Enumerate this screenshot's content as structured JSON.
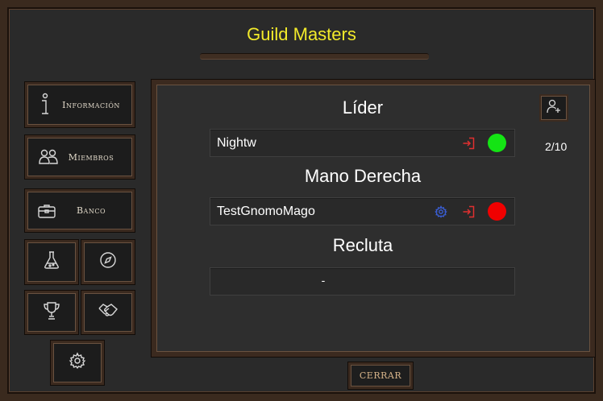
{
  "window": {
    "title": "Guild Masters"
  },
  "sidebar": {
    "info_label": "Información",
    "members_label": "Miembros",
    "bank_label": "Banco"
  },
  "sections": [
    {
      "title": "Líder",
      "members": [
        {
          "name": "Nightw",
          "status": "online",
          "status_color": "#14e414"
        }
      ]
    },
    {
      "title": "Mano Derecha",
      "members": [
        {
          "name": "TestGnomoMago",
          "status": "offline",
          "status_color": "#f00000"
        }
      ]
    },
    {
      "title": "Recluta",
      "empty_text": "-"
    }
  ],
  "member_count": "2/10",
  "footer": {
    "close_label": "CERRAR"
  },
  "colors": {
    "title": "#f2ea2a",
    "accent_exit": "#e03030",
    "accent_settings": "#3a5fd8",
    "frame": "#3a2a1e"
  },
  "icons": [
    "info-icon",
    "members-icon",
    "briefcase-icon",
    "flask-icon",
    "compass-icon",
    "trophy-icon",
    "handshake-icon",
    "gear-icon",
    "add-user-icon",
    "exit-icon",
    "settings-gear-icon"
  ]
}
